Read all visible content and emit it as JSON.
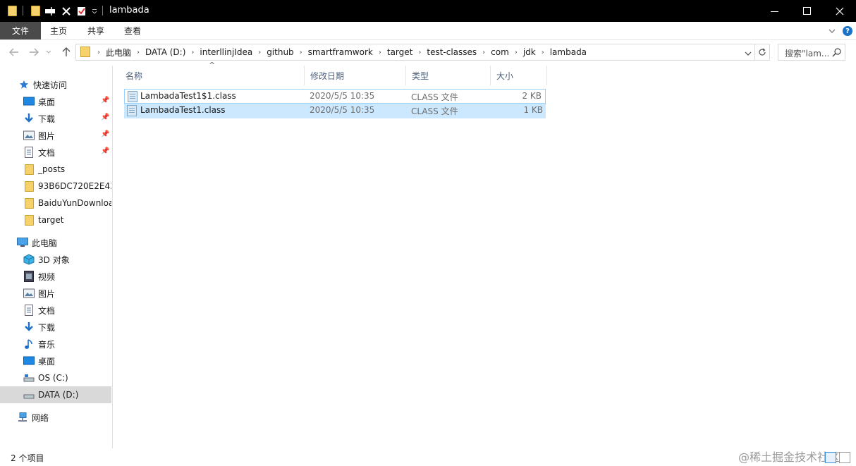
{
  "window": {
    "title": "lambada",
    "controls": {
      "minimize": "—",
      "maximize": "☐",
      "close": "✕"
    }
  },
  "ribbon": {
    "tabs": [
      "文件",
      "主页",
      "共享",
      "查看"
    ]
  },
  "address": {
    "crumbs": [
      "此电脑",
      "DATA (D:)",
      "interllinjIdea",
      "github",
      "smartframwork",
      "target",
      "test-classes",
      "com",
      "jdk",
      "lambada"
    ],
    "search_placeholder": "搜索\"lam..."
  },
  "nav": {
    "items": [
      {
        "label": "快速访问",
        "icon": "star-icon",
        "pinned": false
      },
      {
        "label": "桌面",
        "icon": "desktop-icon",
        "pinned": true
      },
      {
        "label": "下载",
        "icon": "download-icon",
        "pinned": true
      },
      {
        "label": "图片",
        "icon": "pictures-icon",
        "pinned": true
      },
      {
        "label": "文档",
        "icon": "documents-icon",
        "pinned": true
      },
      {
        "label": "_posts",
        "icon": "folder-icon",
        "pinned": false
      },
      {
        "label": "93B6DC720E2E43",
        "icon": "folder-icon",
        "pinned": false
      },
      {
        "label": "BaiduYunDownloa",
        "icon": "folder-icon",
        "pinned": false
      },
      {
        "label": "target",
        "icon": "folder-icon",
        "pinned": false
      },
      {
        "label": "此电脑",
        "icon": "computer-icon",
        "pinned": false
      },
      {
        "label": "3D 对象",
        "icon": "3d-objects-icon",
        "pinned": false
      },
      {
        "label": "视频",
        "icon": "videos-icon",
        "pinned": false
      },
      {
        "label": "图片",
        "icon": "pictures-icon",
        "pinned": false
      },
      {
        "label": "文档",
        "icon": "documents-icon",
        "pinned": false
      },
      {
        "label": "下载",
        "icon": "download-icon",
        "pinned": false
      },
      {
        "label": "音乐",
        "icon": "music-icon",
        "pinned": false
      },
      {
        "label": "桌面",
        "icon": "desktop-icon",
        "pinned": false
      },
      {
        "label": "OS (C:)",
        "icon": "drive-icon",
        "pinned": false
      },
      {
        "label": "DATA (D:)",
        "icon": "drive-icon",
        "pinned": false,
        "selected": true
      },
      {
        "label": "网络",
        "icon": "network-icon",
        "pinned": false
      }
    ]
  },
  "list": {
    "columns": [
      "名称",
      "修改日期",
      "类型",
      "大小"
    ],
    "rows": [
      {
        "name": "LambadaTest1$1.class",
        "date": "2020/5/5 10:35",
        "type": "CLASS 文件",
        "size": "2 KB"
      },
      {
        "name": "LambadaTest1.class",
        "date": "2020/5/5 10:35",
        "type": "CLASS 文件",
        "size": "1 KB"
      }
    ]
  },
  "status": {
    "count": "2 个项目"
  },
  "watermark": "@稀土掘金技术社区"
}
